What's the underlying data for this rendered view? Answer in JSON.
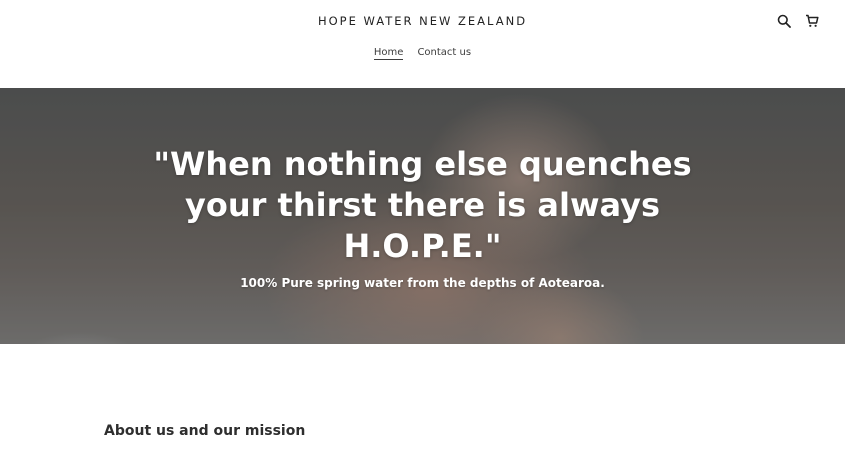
{
  "header": {
    "site_title": "HOPE WATER NEW ZEALAND",
    "icons": {
      "search": "search-icon",
      "cart": "cart-icon"
    },
    "nav": [
      {
        "label": "Home",
        "active": true
      },
      {
        "label": "Contact us",
        "active": false
      }
    ]
  },
  "hero": {
    "title": "\"When nothing else quenches your thirst there is always H.O.P.E.\"",
    "subtitle": "100% Pure spring water from the depths of Aotearoa."
  },
  "about": {
    "heading": "About us and our mission"
  },
  "colors": {
    "text": "#3a3a3a",
    "hero_text": "#ffffff",
    "background": "#ffffff"
  }
}
